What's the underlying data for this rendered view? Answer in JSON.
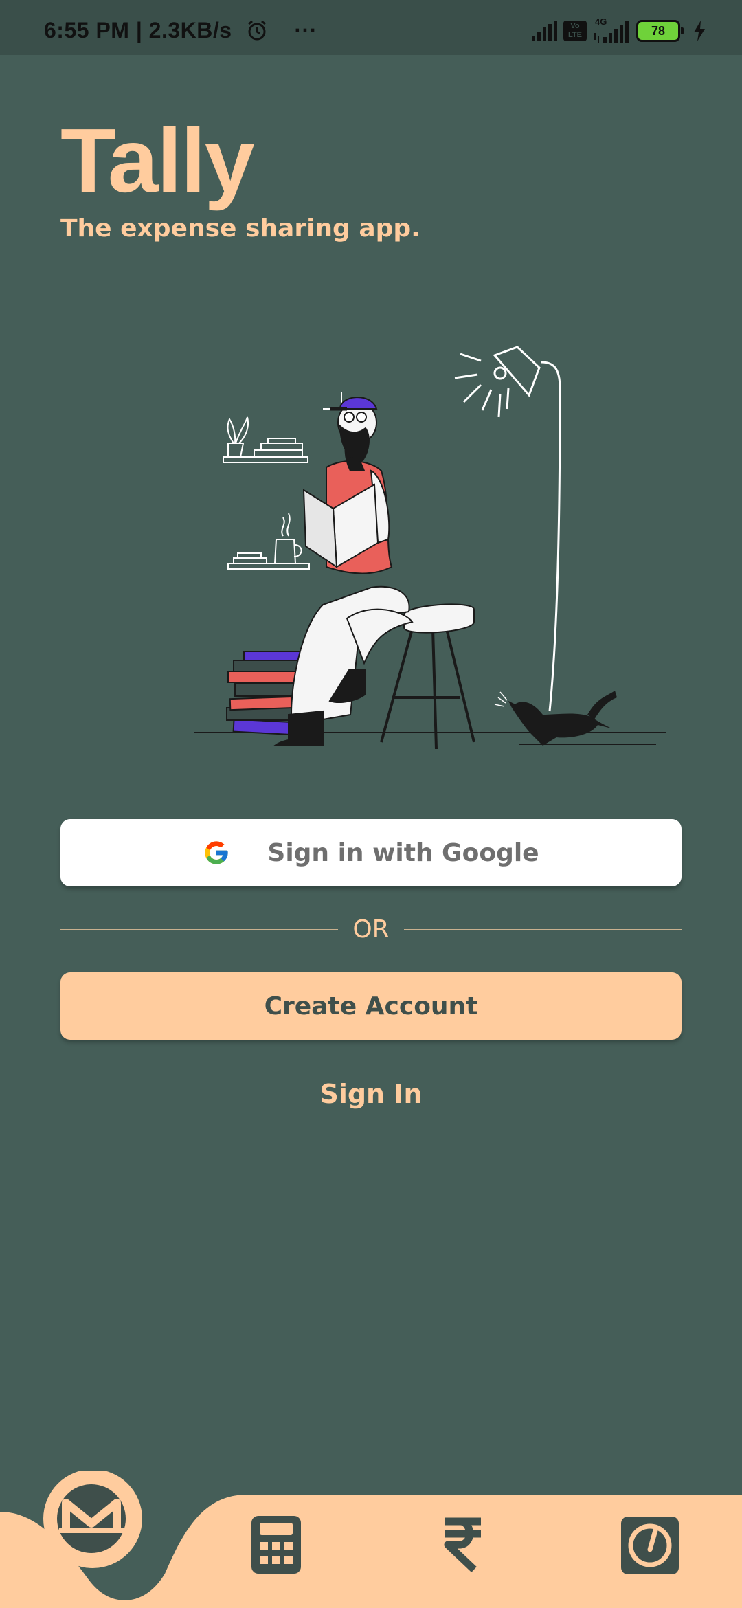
{
  "status_bar": {
    "time_speed": "6:55 PM | 2.3KB/s",
    "more": "···",
    "volte": "Vo LTE",
    "network": "4G",
    "battery": "78"
  },
  "app": {
    "title": "Tally",
    "tagline": "The expense sharing app."
  },
  "auth": {
    "google_label": "Sign in with Google",
    "or_text": "OR",
    "create_account_label": "Create Account",
    "sign_in_label": "Sign In"
  },
  "bottom_nav": {
    "items": [
      {
        "icon": "monero-icon",
        "active": true
      },
      {
        "icon": "calculator-icon",
        "active": false
      },
      {
        "icon": "rupee-icon",
        "active": false
      },
      {
        "icon": "gauge-icon",
        "active": false
      }
    ]
  },
  "colors": {
    "background": "#455e58",
    "accent": "#ffcc9e",
    "button_text": "#3f4f4b",
    "status_bar": "#3a4f4a"
  }
}
